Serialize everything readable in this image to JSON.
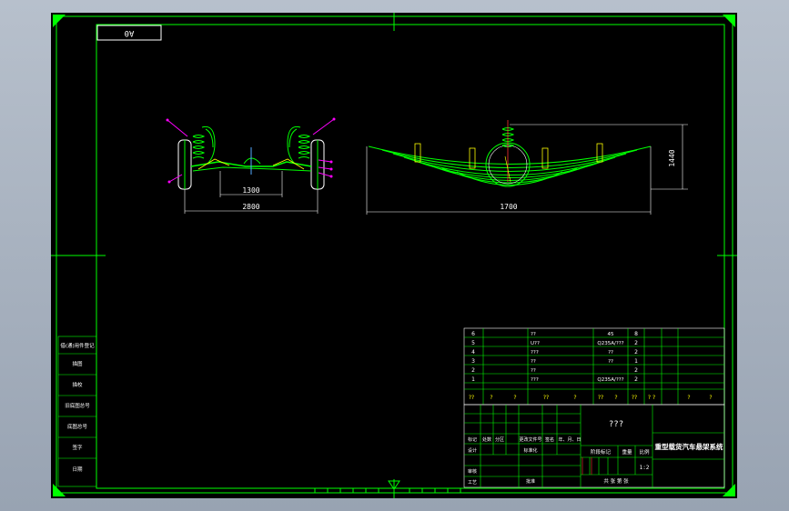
{
  "drawing": {
    "sheet_size": "A0",
    "frame_color": "#00ff00",
    "background": "#000000",
    "part_color": "#ffffff",
    "leader_color": "#ff00ff"
  },
  "front_view": {
    "track_width": "1300",
    "overall_width": "2800"
  },
  "side_view": {
    "span": "1700",
    "height": "1440"
  },
  "bom": {
    "rows": [
      {
        "no": "6",
        "name": "??",
        "material": "45",
        "qty": "8"
      },
      {
        "no": "5",
        "name": "U??",
        "material": "Q235A/???",
        "qty": "2"
      },
      {
        "no": "4",
        "name": "???",
        "material": "??",
        "qty": "2"
      },
      {
        "no": "3",
        "name": "??",
        "material": "??",
        "qty": "1"
      },
      {
        "no": "2",
        "name": "??",
        "material": "",
        "qty": "2"
      },
      {
        "no": "1",
        "name": "???",
        "material": "Q235A/???",
        "qty": "2"
      }
    ],
    "header": [
      "??",
      "?",
      "?",
      "??",
      "?",
      "??",
      "?",
      "??",
      "? ?",
      "?",
      "?"
    ]
  },
  "title_block": {
    "material_mark": "???",
    "drawing_title": "重型载货汽车悬架系统",
    "scale": "1:2",
    "stage_mark": "阶段标记",
    "weight": "重量",
    "ratio": "比例",
    "sheet_info": "共 张 第 张",
    "labels": [
      "标记",
      "处数",
      "分区",
      "更改文件号",
      "签名",
      "年、月、日",
      "设计",
      "标准化",
      "审核",
      "工艺",
      "批准"
    ]
  },
  "side_strip": {
    "labels": [
      "借(通)用件登记",
      "描图",
      "描校",
      "旧底图总号",
      "底图总号",
      "签字",
      "日期"
    ]
  }
}
